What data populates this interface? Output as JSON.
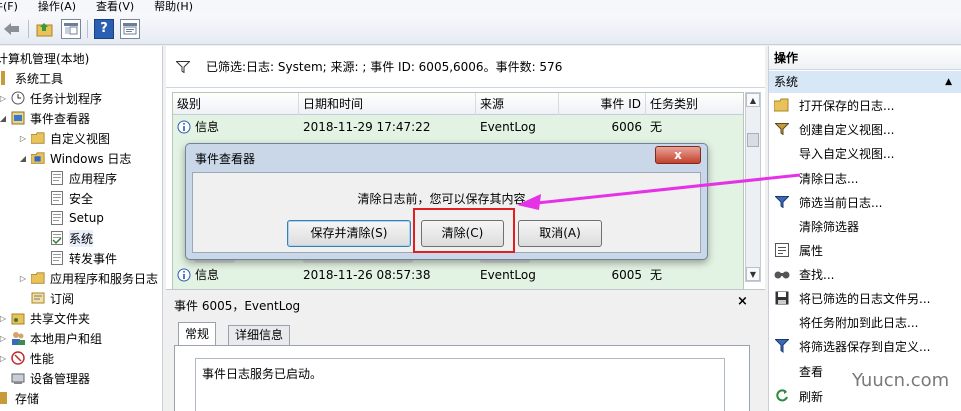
{
  "menu": [
    "件(F)",
    "操作(A)",
    "查看(V)",
    "帮助(H)"
  ],
  "toolbar": {
    "icons": [
      "back-arrow-icon",
      "folder-up-icon",
      "console-tree-icon",
      "help-icon",
      "properties-icon"
    ],
    "help_glyph": "?"
  },
  "tree": {
    "items": [
      {
        "label": "计算机管理(本地)",
        "icon": "computer-icon"
      },
      {
        "label": "系统工具",
        "icon": "tools-icon"
      },
      {
        "label": "任务计划程序",
        "icon": "clock-icon"
      },
      {
        "label": "事件查看器",
        "icon": "event-viewer-icon"
      },
      {
        "label": "自定义视图",
        "icon": "folder-icon"
      },
      {
        "label": "Windows 日志",
        "icon": "folder-icon"
      },
      {
        "label": "应用程序",
        "icon": "log-icon"
      },
      {
        "label": "安全",
        "icon": "log-icon"
      },
      {
        "label": "Setup",
        "icon": "log-icon"
      },
      {
        "label": "系统",
        "icon": "log-icon"
      },
      {
        "label": "转发事件",
        "icon": "log-icon"
      },
      {
        "label": "应用程序和服务日志",
        "icon": "folder-icon"
      },
      {
        "label": "订阅",
        "icon": "subscription-icon"
      },
      {
        "label": "共享文件夹",
        "icon": "share-icon"
      },
      {
        "label": "本地用户和组",
        "icon": "users-icon"
      },
      {
        "label": "性能",
        "icon": "performance-icon"
      },
      {
        "label": "设备管理器",
        "icon": "device-icon"
      },
      {
        "label": "存储",
        "icon": "storage-icon"
      }
    ]
  },
  "filter_bar": {
    "text": "已筛选:日志: System; 来源: ; 事件 ID: 6005,6006。事件数: 576"
  },
  "grid": {
    "columns": [
      "级别",
      "日期和时间",
      "来源",
      "事件 ID",
      "任务类别"
    ],
    "rows": [
      {
        "level": "信息",
        "datetime": "2018-11-29 17:47:22",
        "source": "EventLog",
        "event_id": "6006",
        "category": "无"
      },
      {
        "level": "信息",
        "datetime": "2018-11-26 08:57:38",
        "source": "EventLog",
        "event_id": "6005",
        "category": "无"
      }
    ]
  },
  "detail": {
    "title": "事件 6005，EventLog",
    "close": "×",
    "tabs": [
      "常规",
      "详细信息"
    ],
    "message": "事件日志服务已启动。"
  },
  "actions": {
    "title": "操作",
    "section": "系统",
    "items": [
      {
        "label": "打开保存的日志...",
        "icon": "open-folder-icon"
      },
      {
        "label": "创建自定义视图...",
        "icon": "filter-icon"
      },
      {
        "label": "导入自定义视图...",
        "icon": ""
      },
      {
        "label": "清除日志...",
        "icon": ""
      },
      {
        "label": "筛选当前日志...",
        "icon": "filter-icon"
      },
      {
        "label": "清除筛选器",
        "icon": ""
      },
      {
        "label": "属性",
        "icon": "properties-icon"
      },
      {
        "label": "查找...",
        "icon": "find-icon"
      },
      {
        "label": "将已筛选的日志文件另...",
        "icon": "save-icon"
      },
      {
        "label": "将任务附加到此日志...",
        "icon": ""
      },
      {
        "label": "将筛选器保存到自定义...",
        "icon": "save-filter-icon"
      },
      {
        "label": "查看",
        "icon": ""
      },
      {
        "label": "刷新",
        "icon": "refresh-icon"
      }
    ]
  },
  "dialog": {
    "title": "事件查看器",
    "close": "x",
    "message": "清除日志前，您可以保存其内容。",
    "buttons": {
      "save_clear": "保存并清除(S)",
      "clear": "清除(C)",
      "cancel": "取消(A)"
    }
  },
  "watermark": "Yuucn.com",
  "colors": {
    "grid_row_bg": "#e3f3e3",
    "actions_section_bg": "#d7e7f6",
    "highlight_box": "#e02020",
    "arrow": "#e632e6"
  }
}
